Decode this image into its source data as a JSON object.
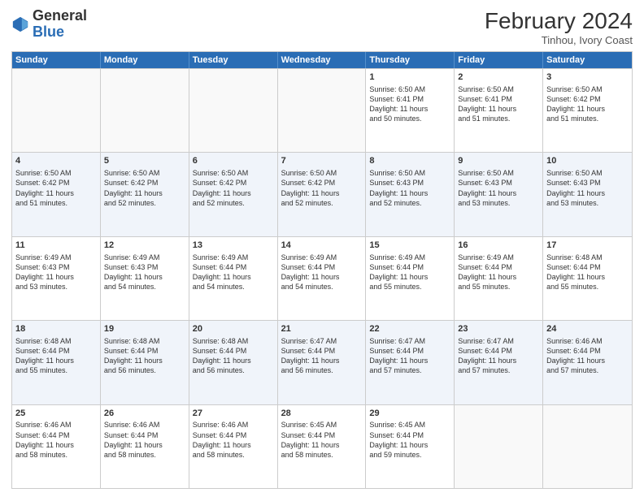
{
  "header": {
    "logo": {
      "general": "General",
      "blue": "Blue"
    },
    "month": "February 2024",
    "location": "Tinhou, Ivory Coast"
  },
  "days": [
    "Sunday",
    "Monday",
    "Tuesday",
    "Wednesday",
    "Thursday",
    "Friday",
    "Saturday"
  ],
  "rows": [
    [
      {
        "day": "",
        "info": ""
      },
      {
        "day": "",
        "info": ""
      },
      {
        "day": "",
        "info": ""
      },
      {
        "day": "",
        "info": ""
      },
      {
        "day": "1",
        "info": "Sunrise: 6:50 AM\nSunset: 6:41 PM\nDaylight: 11 hours\nand 50 minutes."
      },
      {
        "day": "2",
        "info": "Sunrise: 6:50 AM\nSunset: 6:41 PM\nDaylight: 11 hours\nand 51 minutes."
      },
      {
        "day": "3",
        "info": "Sunrise: 6:50 AM\nSunset: 6:42 PM\nDaylight: 11 hours\nand 51 minutes."
      }
    ],
    [
      {
        "day": "4",
        "info": "Sunrise: 6:50 AM\nSunset: 6:42 PM\nDaylight: 11 hours\nand 51 minutes."
      },
      {
        "day": "5",
        "info": "Sunrise: 6:50 AM\nSunset: 6:42 PM\nDaylight: 11 hours\nand 52 minutes."
      },
      {
        "day": "6",
        "info": "Sunrise: 6:50 AM\nSunset: 6:42 PM\nDaylight: 11 hours\nand 52 minutes."
      },
      {
        "day": "7",
        "info": "Sunrise: 6:50 AM\nSunset: 6:42 PM\nDaylight: 11 hours\nand 52 minutes."
      },
      {
        "day": "8",
        "info": "Sunrise: 6:50 AM\nSunset: 6:43 PM\nDaylight: 11 hours\nand 52 minutes."
      },
      {
        "day": "9",
        "info": "Sunrise: 6:50 AM\nSunset: 6:43 PM\nDaylight: 11 hours\nand 53 minutes."
      },
      {
        "day": "10",
        "info": "Sunrise: 6:50 AM\nSunset: 6:43 PM\nDaylight: 11 hours\nand 53 minutes."
      }
    ],
    [
      {
        "day": "11",
        "info": "Sunrise: 6:49 AM\nSunset: 6:43 PM\nDaylight: 11 hours\nand 53 minutes."
      },
      {
        "day": "12",
        "info": "Sunrise: 6:49 AM\nSunset: 6:43 PM\nDaylight: 11 hours\nand 54 minutes."
      },
      {
        "day": "13",
        "info": "Sunrise: 6:49 AM\nSunset: 6:44 PM\nDaylight: 11 hours\nand 54 minutes."
      },
      {
        "day": "14",
        "info": "Sunrise: 6:49 AM\nSunset: 6:44 PM\nDaylight: 11 hours\nand 54 minutes."
      },
      {
        "day": "15",
        "info": "Sunrise: 6:49 AM\nSunset: 6:44 PM\nDaylight: 11 hours\nand 55 minutes."
      },
      {
        "day": "16",
        "info": "Sunrise: 6:49 AM\nSunset: 6:44 PM\nDaylight: 11 hours\nand 55 minutes."
      },
      {
        "day": "17",
        "info": "Sunrise: 6:48 AM\nSunset: 6:44 PM\nDaylight: 11 hours\nand 55 minutes."
      }
    ],
    [
      {
        "day": "18",
        "info": "Sunrise: 6:48 AM\nSunset: 6:44 PM\nDaylight: 11 hours\nand 55 minutes."
      },
      {
        "day": "19",
        "info": "Sunrise: 6:48 AM\nSunset: 6:44 PM\nDaylight: 11 hours\nand 56 minutes."
      },
      {
        "day": "20",
        "info": "Sunrise: 6:48 AM\nSunset: 6:44 PM\nDaylight: 11 hours\nand 56 minutes."
      },
      {
        "day": "21",
        "info": "Sunrise: 6:47 AM\nSunset: 6:44 PM\nDaylight: 11 hours\nand 56 minutes."
      },
      {
        "day": "22",
        "info": "Sunrise: 6:47 AM\nSunset: 6:44 PM\nDaylight: 11 hours\nand 57 minutes."
      },
      {
        "day": "23",
        "info": "Sunrise: 6:47 AM\nSunset: 6:44 PM\nDaylight: 11 hours\nand 57 minutes."
      },
      {
        "day": "24",
        "info": "Sunrise: 6:46 AM\nSunset: 6:44 PM\nDaylight: 11 hours\nand 57 minutes."
      }
    ],
    [
      {
        "day": "25",
        "info": "Sunrise: 6:46 AM\nSunset: 6:44 PM\nDaylight: 11 hours\nand 58 minutes."
      },
      {
        "day": "26",
        "info": "Sunrise: 6:46 AM\nSunset: 6:44 PM\nDaylight: 11 hours\nand 58 minutes."
      },
      {
        "day": "27",
        "info": "Sunrise: 6:46 AM\nSunset: 6:44 PM\nDaylight: 11 hours\nand 58 minutes."
      },
      {
        "day": "28",
        "info": "Sunrise: 6:45 AM\nSunset: 6:44 PM\nDaylight: 11 hours\nand 58 minutes."
      },
      {
        "day": "29",
        "info": "Sunrise: 6:45 AM\nSunset: 6:44 PM\nDaylight: 11 hours\nand 59 minutes."
      },
      {
        "day": "",
        "info": ""
      },
      {
        "day": "",
        "info": ""
      }
    ]
  ]
}
